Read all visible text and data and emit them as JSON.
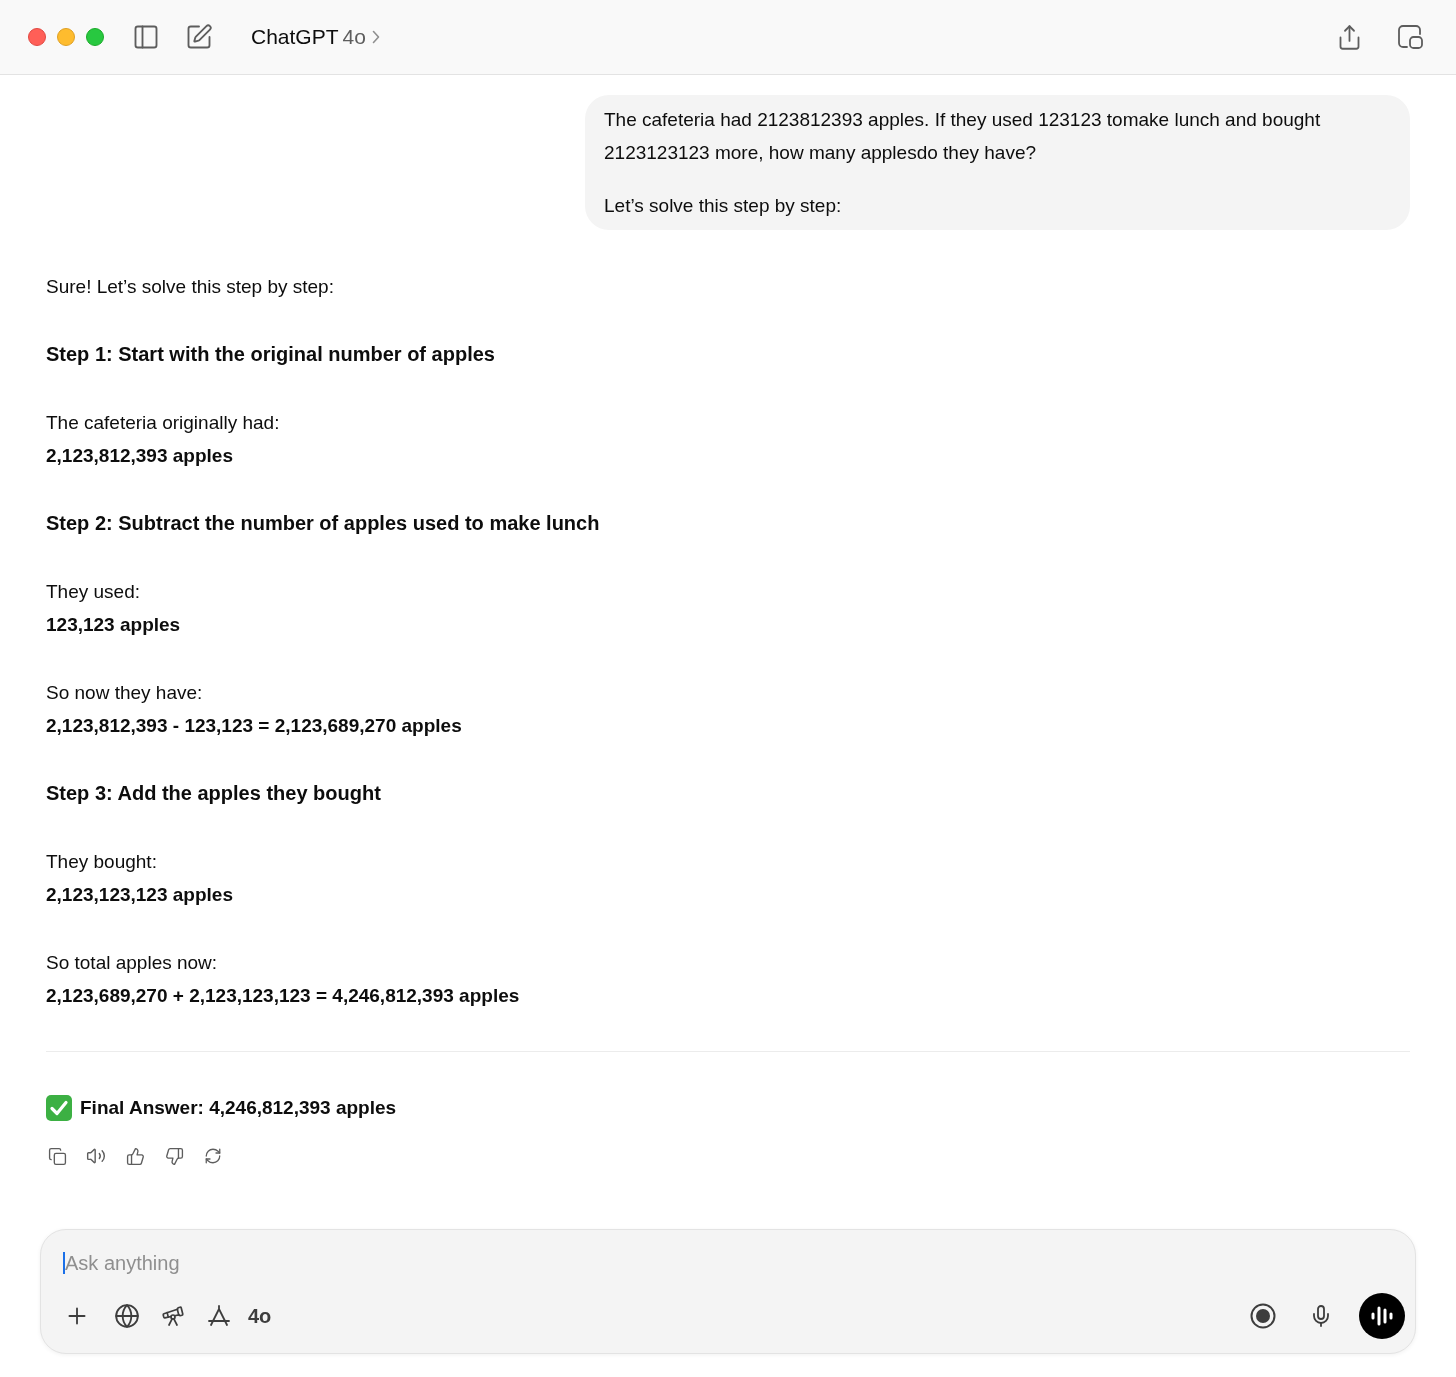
{
  "window": {
    "title": "ChatGPT",
    "model": "4o"
  },
  "user_message": {
    "paragraphs": [
      "The cafeteria had 2123812393 apples. If they used 123123 tomake lunch and bought 2123123123 more, how many applesdo they have?",
      "Let’s solve this step by step:"
    ]
  },
  "assistant_message": {
    "blocks": [
      {
        "kind": "paragraph",
        "text": "Sure! Let’s solve this step by step:"
      },
      {
        "kind": "heading",
        "text": "Step 1: Start with the original number of apples"
      },
      {
        "kind": "fact",
        "label": "The cafeteria originally had:",
        "value": "2,123,812,393 apples"
      },
      {
        "kind": "heading",
        "text": "Step 2: Subtract the number of apples used to make lunch"
      },
      {
        "kind": "fact",
        "label": "They used:",
        "value": "123,123 apples"
      },
      {
        "kind": "fact",
        "label": "So now they have:",
        "value": "2,123,812,393 - 123,123 = 2,123,689,270 apples"
      },
      {
        "kind": "heading",
        "text": "Step 3: Add the apples they bought"
      },
      {
        "kind": "fact",
        "label": "They bought:",
        "value": "2,123,123,123 apples"
      },
      {
        "kind": "fact",
        "label": "So total apples now:",
        "value": "2,123,689,270 + 2,123,123,123 = 4,246,812,393 apples"
      },
      {
        "kind": "divider"
      },
      {
        "kind": "answer",
        "text": "Final Answer: 4,246,812,393 apples"
      }
    ]
  },
  "composer": {
    "placeholder": "Ask anything",
    "model": "4o"
  }
}
